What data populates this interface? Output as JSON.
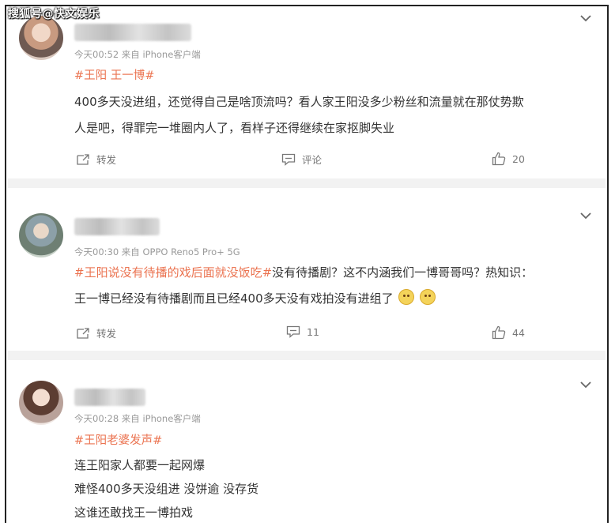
{
  "watermark": "搜狐号@快文娱乐",
  "comments": [
    {
      "meta": "今天00:52  来自 iPhone客户端",
      "topic": "#王阳 王一博#",
      "lines": [
        "400多天没进组，还觉得自己是啥顶流吗？看人家王阳没多少粉丝和流量就在那仗势欺",
        "人是吧，得罪完一堆圈内人了，看样子还得继续在家抠脚失业"
      ],
      "actions": {
        "repost": "转发",
        "comment": "评论",
        "likes": "20"
      }
    },
    {
      "meta": "今天00:30  来自 OPPO Reno5 Pro+ 5G",
      "topic": "#王阳说没有待播的戏后面就没饭吃#",
      "topic_tail": "没有待播剧？这不内涵我们一博哥哥吗？热知识：",
      "lines": [
        "王一博已经没有待播剧而且已经400多天没有戏拍没有进组了"
      ],
      "actions": {
        "repost": "转发",
        "comment": "11",
        "likes": "44"
      }
    },
    {
      "meta": "今天00:28  来自 iPhone客户端",
      "topic": "#王阳老婆发声#",
      "lines": [
        "连王阳家人都要一起网爆",
        "难怪400多天没组进 没饼逾 没存货",
        "这谁还敢找王一博拍戏"
      ]
    }
  ],
  "icons": {
    "chevron": "chevron-down-icon",
    "repost": "repost-icon",
    "comment": "comment-icon",
    "like": "thumbs-up-icon"
  },
  "colors": {
    "topic": "#eb7350",
    "text": "#333333",
    "meta": "#9a9a9a",
    "separator": "#f2f2f2"
  }
}
